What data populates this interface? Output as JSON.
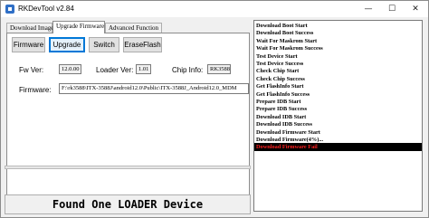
{
  "window": {
    "title": "RKDevTool v2.84",
    "icon": "app-icon",
    "controls": [
      "minimize-icon",
      "maximize-icon",
      "close-icon"
    ]
  },
  "tabs": [
    {
      "label": "Download Image",
      "active": false
    },
    {
      "label": "Upgrade Firmware",
      "active": true
    },
    {
      "label": "Advanced Function",
      "active": false
    }
  ],
  "buttons": {
    "firmware": "Firmware",
    "upgrade": "Upgrade",
    "switch": "Switch",
    "eraseflash": "EraseFlash"
  },
  "info": {
    "fw_ver_label": "Fw Ver:",
    "fw_ver_value": "12.0.00",
    "loader_ver_label": "Loader Ver:",
    "loader_ver_value": "1.01",
    "chip_info_label": "Chip Info:",
    "chip_info_value": "RK3588",
    "firmware_label": "Firmware:",
    "firmware_path": "F:\\rk3588\\ITX-3588J\\android12.0\\Public\\ITX-3588J_Android12.0_MDM"
  },
  "progress": {
    "fraction": 0.0,
    "fill_color": "#06b025"
  },
  "status_text": "Found One LOADER Device",
  "log": [
    {
      "text": "Download Boot Start",
      "error": false
    },
    {
      "text": "Download Boot Success",
      "error": false
    },
    {
      "text": "Wait For Maskrom Start",
      "error": false
    },
    {
      "text": "Wait For Maskrom Success",
      "error": false
    },
    {
      "text": "Test Device Start",
      "error": false
    },
    {
      "text": "Test Device Success",
      "error": false
    },
    {
      "text": "Check Chip Start",
      "error": false
    },
    {
      "text": "Check Chip Success",
      "error": false
    },
    {
      "text": "Get FlashInfo Start",
      "error": false
    },
    {
      "text": "Get FlashInfo Success",
      "error": false
    },
    {
      "text": "Prepare IDB Start",
      "error": false
    },
    {
      "text": "Prepare IDB Success",
      "error": false
    },
    {
      "text": "Download IDB Start",
      "error": false
    },
    {
      "text": "Download IDB Success",
      "error": false
    },
    {
      "text": "Download Firmware Start",
      "error": false
    },
    {
      "text": "Download Firmware(4%)...",
      "error": false
    },
    {
      "text": "Download Firmware Fail",
      "error": true
    }
  ],
  "colors": {
    "accent": "#0078d7",
    "error_bg": "#000000",
    "error_text": "#ff2020"
  }
}
